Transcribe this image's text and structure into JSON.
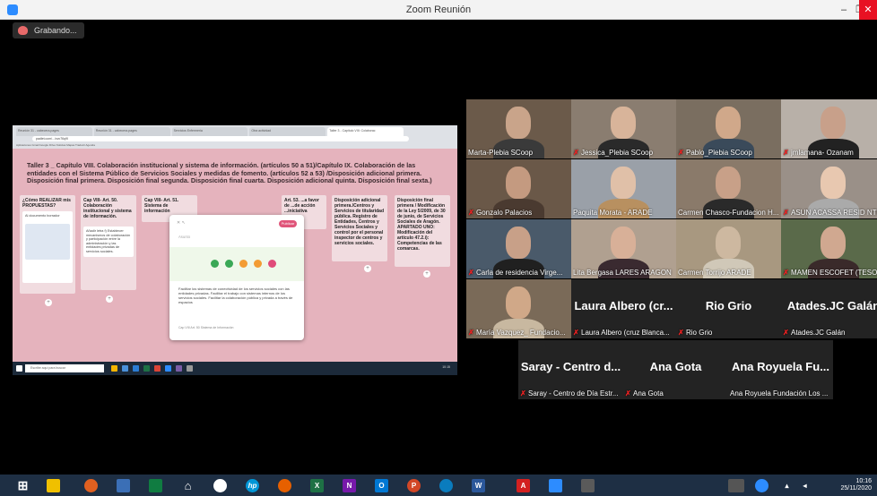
{
  "window": {
    "title": "Zoom Reunión",
    "minimize": "–",
    "maximize": "❐",
    "close": "✕"
  },
  "recording": {
    "label": "Grabando..."
  },
  "share": {
    "tabs": [
      "Reunión 31 - cabecera.pages",
      "Reunión 31 - cabecera.pages",
      "Servicios Enfermeria",
      "Otra actividad",
      "Taller 3 - Capitulo VIII: Colaborac"
    ],
    "url": "padlet.com/.../xvc76q9l",
    "bookmarks": "Aplicaciones   Gmail   Google   Drive   Noticias   Mapas   Traducir   Agenda",
    "padlet_title": "Taller 3 _ Capítulo VIII. Colaboración institucional y sistema de información. (artículos 50 a 51)/Capítulo IX. Colaboración de las entidades con el Sistema Público de Servicios Sociales y medidas de fomento. (artículos 52 a 53) /Disposición adicional primera. Disposición final primera. Disposición final segunda. Disposición final cuarta. Disposición adicional quinta. Disposición final sexta.)",
    "columns": [
      {
        "head": "¿Cómo REALIZAR mis PROPUESTAS?",
        "card": "Al documento borrador"
      },
      {
        "head": "Cap VIII- Art. 50. Colaboración institucional y sistema de información.",
        "card": "Añadir letra f) Establecer mecanismos de colaboración y participación entre la administración y las entidades privadas de servicios sociales."
      },
      {
        "head": "Cap VIII- Art. 51. Sistema de información",
        "card": ""
      },
      {
        "head": "Art. 53. ...a favor de ...de acción ...iniciativa",
        "card": ""
      },
      {
        "head": "Disposición adicional primera./Centros y Servicios de titularidad pública. Registro de Entidades, Centros y Servicios Sociales y control por el personal inspector de centros y servicios sociales.",
        "card": ""
      },
      {
        "head": "Disposición final primera / Modificación de la Ley 5/2009, de 30 de junio, de Servicios Sociales de Aragón. APARTADO UNO: Modificación del artículo 47.2.i): Competencias de las comarcas.",
        "card": ""
      }
    ],
    "modal": {
      "publish": "Publicar",
      "subject": "Asunto",
      "body": "Facilitar los sistemas de conectividad de los servicios sociales con las entidades privadas. Facilitar el trabajo con sistemas internos de los servicios sociales. Facilitar la colaboración pública y privada a través de espacios",
      "footer": "Cap VIII Art. 50 Sistema de Información"
    },
    "taskbar_search": "Escribe aquí para buscar",
    "taskbar_clock": "10:15"
  },
  "participants": [
    {
      "name": "Marta-Plebia SCoop",
      "muted": false
    },
    {
      "name": "Jessica_Plebia SCoop",
      "muted": true
    },
    {
      "name": "Pablo_Plebia SCoop",
      "muted": true
    },
    {
      "name": "jmlamana-  Ozanam",
      "muted": true
    },
    {
      "name": "Gonzalo Palacios",
      "muted": true
    },
    {
      "name": "Paquita Morata - ARADE",
      "muted": false
    },
    {
      "name": "Carmen Chasco-Fundacion H...",
      "muted": false
    },
    {
      "name": "ASUN  ACASSA  RESID  NTR...",
      "muted": true
    },
    {
      "name": "Carla de residencia Virge...",
      "muted": true
    },
    {
      "name": "Lita Bergasa LARES ARAGON",
      "muted": false
    },
    {
      "name": "Carmen Torrijo ARADE",
      "muted": false
    },
    {
      "name": "MAMEN ESCOFET (TESO...",
      "muted": true
    },
    {
      "name": "María Vazquez_ Fundacio...",
      "muted": true
    },
    {
      "name": "Laura Albero (cruz Blanca...",
      "muted": true,
      "big": "Laura Albero  (cr..."
    },
    {
      "name": "Rio Grio",
      "muted": true,
      "big": "Rio Grio"
    },
    {
      "name": "Atades.JC Galán",
      "muted": true,
      "big": "Atades.JC Galán"
    },
    {
      "name": "Saray - Centro de Día Estr...",
      "muted": true,
      "big": "Saray - Centro d..."
    },
    {
      "name": "Ana Gota",
      "muted": true,
      "big": "Ana Gota"
    },
    {
      "name": "Ana Royuela Fundación Los ...",
      "muted": false,
      "big": "Ana Royuela Fu..."
    }
  ],
  "tray": {
    "time": "10:16",
    "date": "25/11/2020"
  }
}
